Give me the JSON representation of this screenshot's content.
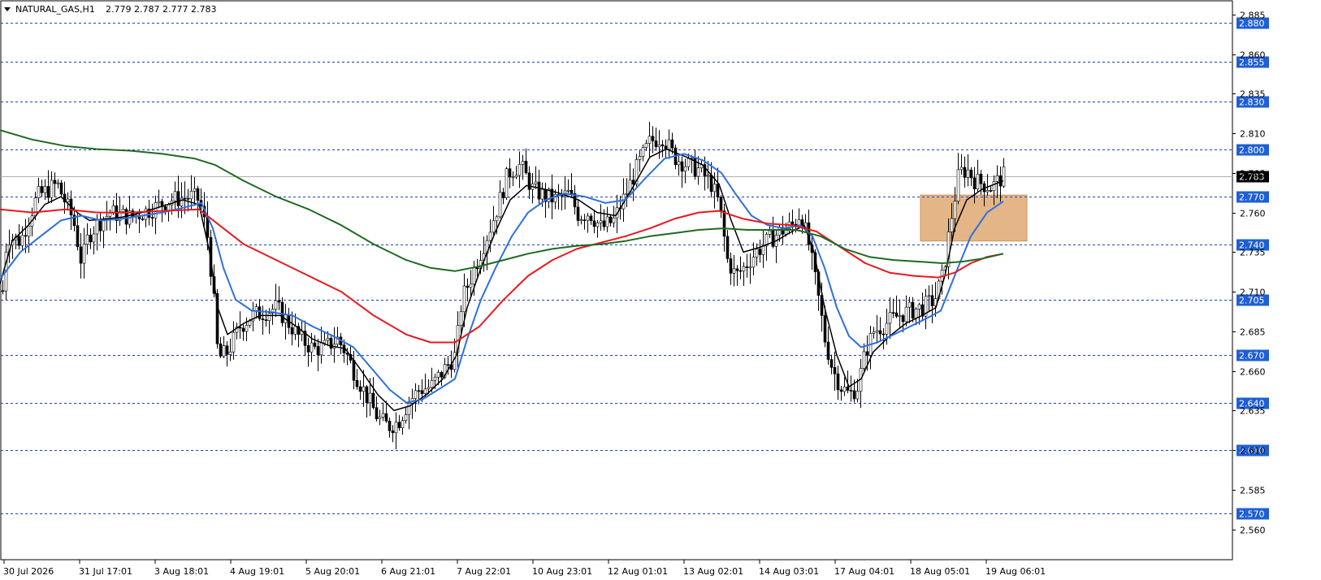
{
  "header": {
    "symbol": "NATURAL_GAS,H1",
    "ohlc": "2.779 2.787 2.777 2.783"
  },
  "colors": {
    "background": "#ffffff",
    "candle": "#000000",
    "level_line": "#1f3fbf",
    "level_label_bg": "#1f5fd6",
    "ma_fast": "#000000",
    "ma_medium": "#2e6fe0",
    "ma_slow": "#e8191e",
    "ma_long": "#1f6b22",
    "zone": "#dfa972",
    "current_price_bg": "#000000"
  },
  "chart_data": {
    "type": "line",
    "title": "NATURAL_GAS,H1",
    "ohlc_text": "2.779 2.787 2.777 2.783",
    "x_tick_labels": [
      "30 Jul 2026",
      "31 Jul 17:01",
      "3 Aug 18:01",
      "4 Aug 19:01",
      "5 Aug 20:01",
      "6 Aug 21:01",
      "7 Aug 22:01",
      "10 Aug 23:01",
      "12 Aug 01:01",
      "13 Aug 02:01",
      "14 Aug 03:01",
      "17 Aug 04:01",
      "18 Aug 05:01",
      "19 Aug 06:01"
    ],
    "y_axis_ticks": [
      "2.885",
      "2.860",
      "2.835",
      "2.810",
      "2.785",
      "2.760",
      "2.735",
      "2.710",
      "2.685",
      "2.660",
      "2.635",
      "2.610",
      "2.585",
      "2.560"
    ],
    "ylim": [
      2.55,
      2.888
    ],
    "grid": false,
    "horizontal_levels": [
      2.88,
      2.855,
      2.83,
      2.8,
      2.77,
      2.74,
      2.705,
      2.67,
      2.64,
      2.61,
      2.57
    ],
    "level_labels": [
      "2.880",
      "2.855",
      "2.830",
      "2.800",
      "2.770",
      "2.740",
      "2.705",
      "2.670",
      "2.640",
      "2.610",
      "2.570"
    ],
    "current_price": 2.783,
    "current_price_label": "2.783",
    "zone": {
      "x_start": "18 Aug 06:00",
      "x_end": "19 Aug 09:00",
      "y_low": 2.742,
      "y_high": 2.771
    },
    "price_path": [
      [
        0,
        2.69
      ],
      [
        8,
        2.745
      ],
      [
        25,
        2.742
      ],
      [
        45,
        2.77
      ],
      [
        70,
        2.778
      ],
      [
        90,
        2.755
      ],
      [
        100,
        2.728
      ],
      [
        108,
        2.745
      ],
      [
        118,
        2.752
      ],
      [
        135,
        2.76
      ],
      [
        160,
        2.757
      ],
      [
        185,
        2.762
      ],
      [
        210,
        2.768
      ],
      [
        235,
        2.77
      ],
      [
        245,
        2.768
      ],
      [
        255,
        2.745
      ],
      [
        262,
        2.71
      ],
      [
        268,
        2.668
      ],
      [
        280,
        2.672
      ],
      [
        295,
        2.688
      ],
      [
        310,
        2.695
      ],
      [
        325,
        2.697
      ],
      [
        340,
        2.7
      ],
      [
        355,
        2.69
      ],
      [
        370,
        2.68
      ],
      [
        385,
        2.674
      ],
      [
        400,
        2.675
      ],
      [
        415,
        2.68
      ],
      [
        425,
        2.672
      ],
      [
        435,
        2.66
      ],
      [
        450,
        2.645
      ],
      [
        465,
        2.63
      ],
      [
        478,
        2.625
      ],
      [
        490,
        2.628
      ],
      [
        502,
        2.64
      ],
      [
        515,
        2.648
      ],
      [
        530,
        2.65
      ],
      [
        545,
        2.66
      ],
      [
        560,
        2.67
      ],
      [
        568,
        2.705
      ],
      [
        580,
        2.72
      ],
      [
        595,
        2.74
      ],
      [
        610,
        2.76
      ],
      [
        625,
        2.785
      ],
      [
        640,
        2.79
      ],
      [
        655,
        2.775
      ],
      [
        670,
        2.77
      ],
      [
        685,
        2.768
      ],
      [
        700,
        2.772
      ],
      [
        712,
        2.758
      ],
      [
        725,
        2.76
      ],
      [
        740,
        2.75
      ],
      [
        755,
        2.755
      ],
      [
        770,
        2.772
      ],
      [
        785,
        2.79
      ],
      [
        800,
        2.805
      ],
      [
        815,
        2.808
      ],
      [
        830,
        2.795
      ],
      [
        845,
        2.79
      ],
      [
        860,
        2.787
      ],
      [
        875,
        2.778
      ],
      [
        885,
        2.765
      ],
      [
        895,
        2.73
      ],
      [
        905,
        2.72
      ],
      [
        915,
        2.725
      ],
      [
        930,
        2.735
      ],
      [
        945,
        2.742
      ],
      [
        960,
        2.748
      ],
      [
        975,
        2.752
      ],
      [
        985,
        2.76
      ],
      [
        995,
        2.74
      ],
      [
        1005,
        2.712
      ],
      [
        1015,
        2.68
      ],
      [
        1025,
        2.66
      ],
      [
        1035,
        2.65
      ],
      [
        1045,
        2.645
      ],
      [
        1055,
        2.65
      ],
      [
        1065,
        2.672
      ],
      [
        1075,
        2.685
      ],
      [
        1090,
        2.69
      ],
      [
        1105,
        2.695
      ],
      [
        1120,
        2.698
      ],
      [
        1135,
        2.7
      ],
      [
        1150,
        2.705
      ],
      [
        1160,
        2.72
      ],
      [
        1170,
        2.755
      ],
      [
        1180,
        2.785
      ],
      [
        1190,
        2.787
      ],
      [
        1200,
        2.78
      ],
      [
        1210,
        2.778
      ],
      [
        1220,
        2.776
      ],
      [
        1230,
        2.781
      ],
      [
        1235,
        2.783
      ]
    ],
    "series": [
      {
        "key": "ma_fast",
        "color": "#000000",
        "values": [
          [
            0,
            2.715
          ],
          [
            15,
            2.742
          ],
          [
            35,
            2.752
          ],
          [
            55,
            2.765
          ],
          [
            75,
            2.77
          ],
          [
            95,
            2.76
          ],
          [
            110,
            2.755
          ],
          [
            130,
            2.756
          ],
          [
            150,
            2.757
          ],
          [
            175,
            2.76
          ],
          [
            200,
            2.764
          ],
          [
            225,
            2.768
          ],
          [
            245,
            2.765
          ],
          [
            258,
            2.735
          ],
          [
            268,
            2.7
          ],
          [
            280,
            2.683
          ],
          [
            300,
            2.69
          ],
          [
            320,
            2.695
          ],
          [
            345,
            2.695
          ],
          [
            365,
            2.688
          ],
          [
            385,
            2.68
          ],
          [
            405,
            2.676
          ],
          [
            425,
            2.674
          ],
          [
            445,
            2.66
          ],
          [
            465,
            2.645
          ],
          [
            485,
            2.635
          ],
          [
            505,
            2.638
          ],
          [
            525,
            2.645
          ],
          [
            545,
            2.655
          ],
          [
            562,
            2.67
          ],
          [
            575,
            2.7
          ],
          [
            592,
            2.725
          ],
          [
            610,
            2.748
          ],
          [
            628,
            2.768
          ],
          [
            648,
            2.777
          ],
          [
            668,
            2.775
          ],
          [
            690,
            2.772
          ],
          [
            712,
            2.768
          ],
          [
            735,
            2.76
          ],
          [
            758,
            2.758
          ],
          [
            778,
            2.775
          ],
          [
            800,
            2.795
          ],
          [
            820,
            2.8
          ],
          [
            845,
            2.795
          ],
          [
            865,
            2.79
          ],
          [
            885,
            2.778
          ],
          [
            900,
            2.755
          ],
          [
            915,
            2.735
          ],
          [
            935,
            2.738
          ],
          [
            955,
            2.742
          ],
          [
            975,
            2.748
          ],
          [
            990,
            2.752
          ],
          [
            1002,
            2.735
          ],
          [
            1015,
            2.7
          ],
          [
            1030,
            2.67
          ],
          [
            1045,
            2.65
          ],
          [
            1060,
            2.655
          ],
          [
            1075,
            2.672
          ],
          [
            1095,
            2.682
          ],
          [
            1115,
            2.69
          ],
          [
            1135,
            2.695
          ],
          [
            1152,
            2.7
          ],
          [
            1163,
            2.72
          ],
          [
            1175,
            2.75
          ],
          [
            1190,
            2.768
          ],
          [
            1210,
            2.775
          ],
          [
            1235,
            2.78
          ]
        ]
      },
      {
        "key": "ma_medium",
        "color": "#2e6fe0",
        "values": [
          [
            0,
            2.718
          ],
          [
            25,
            2.735
          ],
          [
            50,
            2.745
          ],
          [
            75,
            2.755
          ],
          [
            100,
            2.758
          ],
          [
            125,
            2.755
          ],
          [
            150,
            2.756
          ],
          [
            175,
            2.758
          ],
          [
            200,
            2.76
          ],
          [
            225,
            2.763
          ],
          [
            248,
            2.766
          ],
          [
            262,
            2.75
          ],
          [
            275,
            2.725
          ],
          [
            290,
            2.705
          ],
          [
            310,
            2.698
          ],
          [
            335,
            2.697
          ],
          [
            360,
            2.695
          ],
          [
            385,
            2.688
          ],
          [
            410,
            2.682
          ],
          [
            435,
            2.675
          ],
          [
            460,
            2.66
          ],
          [
            480,
            2.648
          ],
          [
            500,
            2.64
          ],
          [
            520,
            2.642
          ],
          [
            545,
            2.65
          ],
          [
            560,
            2.655
          ],
          [
            575,
            2.68
          ],
          [
            592,
            2.705
          ],
          [
            610,
            2.725
          ],
          [
            630,
            2.745
          ],
          [
            650,
            2.76
          ],
          [
            672,
            2.768
          ],
          [
            695,
            2.772
          ],
          [
            720,
            2.77
          ],
          [
            745,
            2.766
          ],
          [
            770,
            2.768
          ],
          [
            795,
            2.782
          ],
          [
            818,
            2.794
          ],
          [
            842,
            2.797
          ],
          [
            865,
            2.793
          ],
          [
            888,
            2.785
          ],
          [
            905,
            2.772
          ],
          [
            925,
            2.758
          ],
          [
            945,
            2.752
          ],
          [
            965,
            2.75
          ],
          [
            985,
            2.752
          ],
          [
            1000,
            2.745
          ],
          [
            1015,
            2.725
          ],
          [
            1030,
            2.7
          ],
          [
            1045,
            2.682
          ],
          [
            1060,
            2.675
          ],
          [
            1080,
            2.678
          ],
          [
            1100,
            2.683
          ],
          [
            1120,
            2.688
          ],
          [
            1140,
            2.693
          ],
          [
            1158,
            2.698
          ],
          [
            1175,
            2.72
          ],
          [
            1195,
            2.745
          ],
          [
            1215,
            2.76
          ],
          [
            1235,
            2.767
          ]
        ]
      },
      {
        "key": "ma_slow",
        "color": "#e8191e",
        "values": [
          [
            0,
            2.762
          ],
          [
            40,
            2.76
          ],
          [
            80,
            2.762
          ],
          [
            120,
            2.76
          ],
          [
            160,
            2.76
          ],
          [
            200,
            2.761
          ],
          [
            245,
            2.762
          ],
          [
            270,
            2.752
          ],
          [
            300,
            2.74
          ],
          [
            340,
            2.73
          ],
          [
            380,
            2.72
          ],
          [
            420,
            2.71
          ],
          [
            460,
            2.695
          ],
          [
            500,
            2.683
          ],
          [
            530,
            2.678
          ],
          [
            560,
            2.678
          ],
          [
            590,
            2.688
          ],
          [
            620,
            2.705
          ],
          [
            650,
            2.72
          ],
          [
            680,
            2.73
          ],
          [
            710,
            2.737
          ],
          [
            740,
            2.741
          ],
          [
            770,
            2.745
          ],
          [
            800,
            2.75
          ],
          [
            830,
            2.756
          ],
          [
            860,
            2.76
          ],
          [
            885,
            2.761
          ],
          [
            915,
            2.756
          ],
          [
            945,
            2.753
          ],
          [
            975,
            2.752
          ],
          [
            1005,
            2.748
          ],
          [
            1035,
            2.738
          ],
          [
            1065,
            2.728
          ],
          [
            1095,
            2.722
          ],
          [
            1125,
            2.72
          ],
          [
            1155,
            2.719
          ],
          [
            1175,
            2.722
          ],
          [
            1195,
            2.728
          ],
          [
            1215,
            2.732
          ],
          [
            1235,
            2.734
          ]
        ]
      },
      {
        "key": "ma_long",
        "color": "#1f6b22",
        "values": [
          [
            0,
            2.812
          ],
          [
            40,
            2.806
          ],
          [
            80,
            2.802
          ],
          [
            120,
            2.8
          ],
          [
            160,
            2.799
          ],
          [
            200,
            2.797
          ],
          [
            240,
            2.794
          ],
          [
            265,
            2.79
          ],
          [
            300,
            2.78
          ],
          [
            340,
            2.77
          ],
          [
            380,
            2.762
          ],
          [
            420,
            2.752
          ],
          [
            460,
            2.74
          ],
          [
            500,
            2.73
          ],
          [
            530,
            2.725
          ],
          [
            560,
            2.723
          ],
          [
            590,
            2.726
          ],
          [
            620,
            2.73
          ],
          [
            650,
            2.734
          ],
          [
            680,
            2.737
          ],
          [
            710,
            2.739
          ],
          [
            740,
            2.74
          ],
          [
            770,
            2.742
          ],
          [
            800,
            2.745
          ],
          [
            830,
            2.747
          ],
          [
            860,
            2.749
          ],
          [
            890,
            2.75
          ],
          [
            920,
            2.749
          ],
          [
            950,
            2.749
          ],
          [
            980,
            2.749
          ],
          [
            1010,
            2.745
          ],
          [
            1040,
            2.737
          ],
          [
            1070,
            2.732
          ],
          [
            1100,
            2.73
          ],
          [
            1130,
            2.729
          ],
          [
            1160,
            2.728
          ],
          [
            1185,
            2.729
          ],
          [
            1210,
            2.731
          ],
          [
            1235,
            2.734
          ]
        ]
      }
    ]
  }
}
